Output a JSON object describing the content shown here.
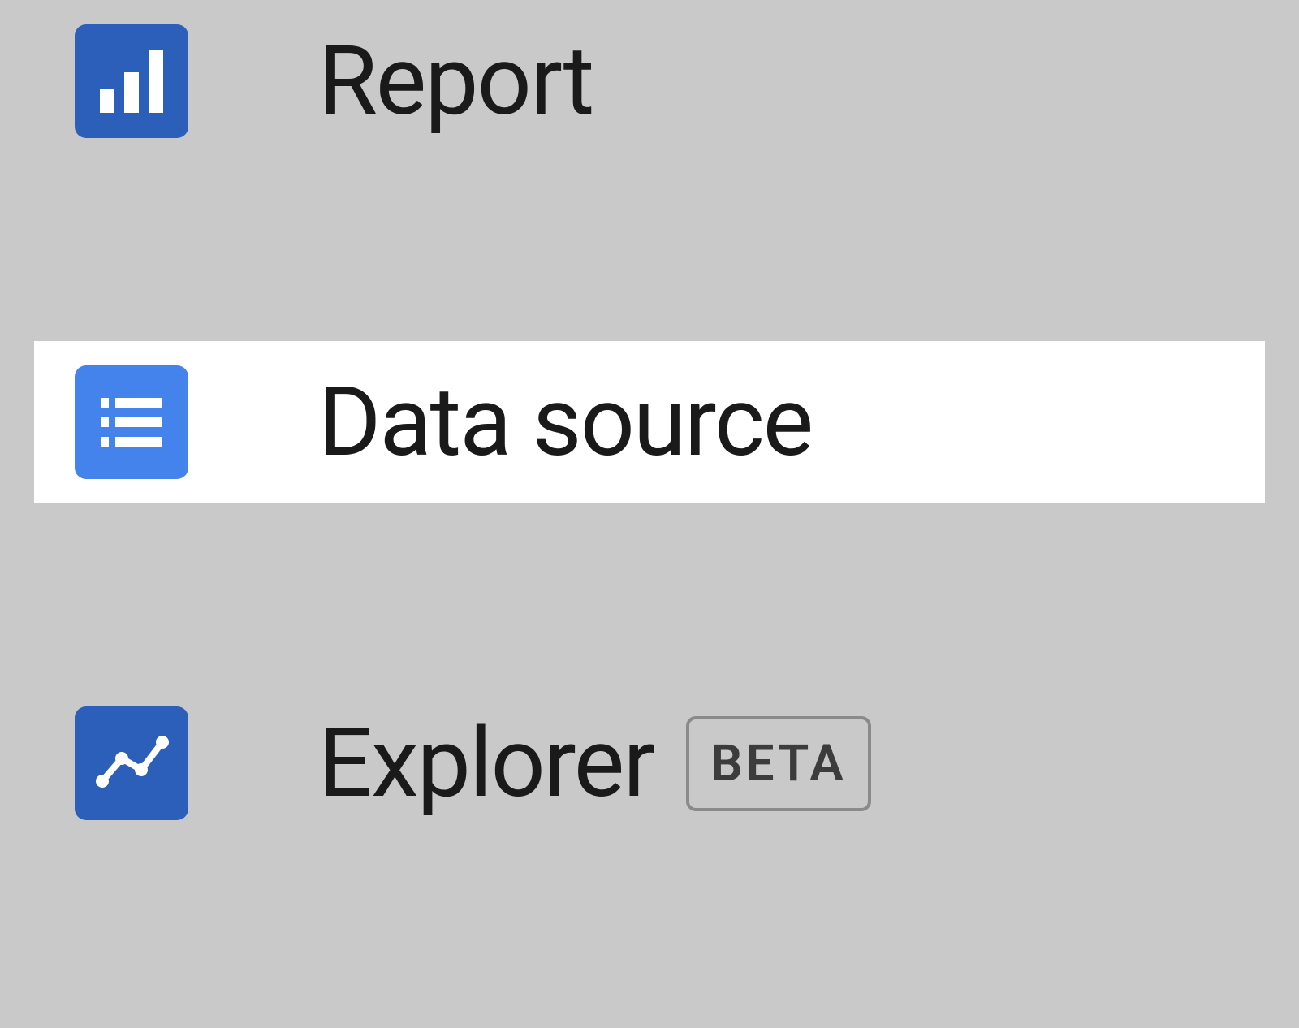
{
  "menu": {
    "items": [
      {
        "label": "Report",
        "icon": "bar-chart-icon",
        "badge": null
      },
      {
        "label": "Data source",
        "icon": "list-icon",
        "badge": null
      },
      {
        "label": "Explorer",
        "icon": "line-chart-icon",
        "badge": "BETA"
      }
    ]
  }
}
